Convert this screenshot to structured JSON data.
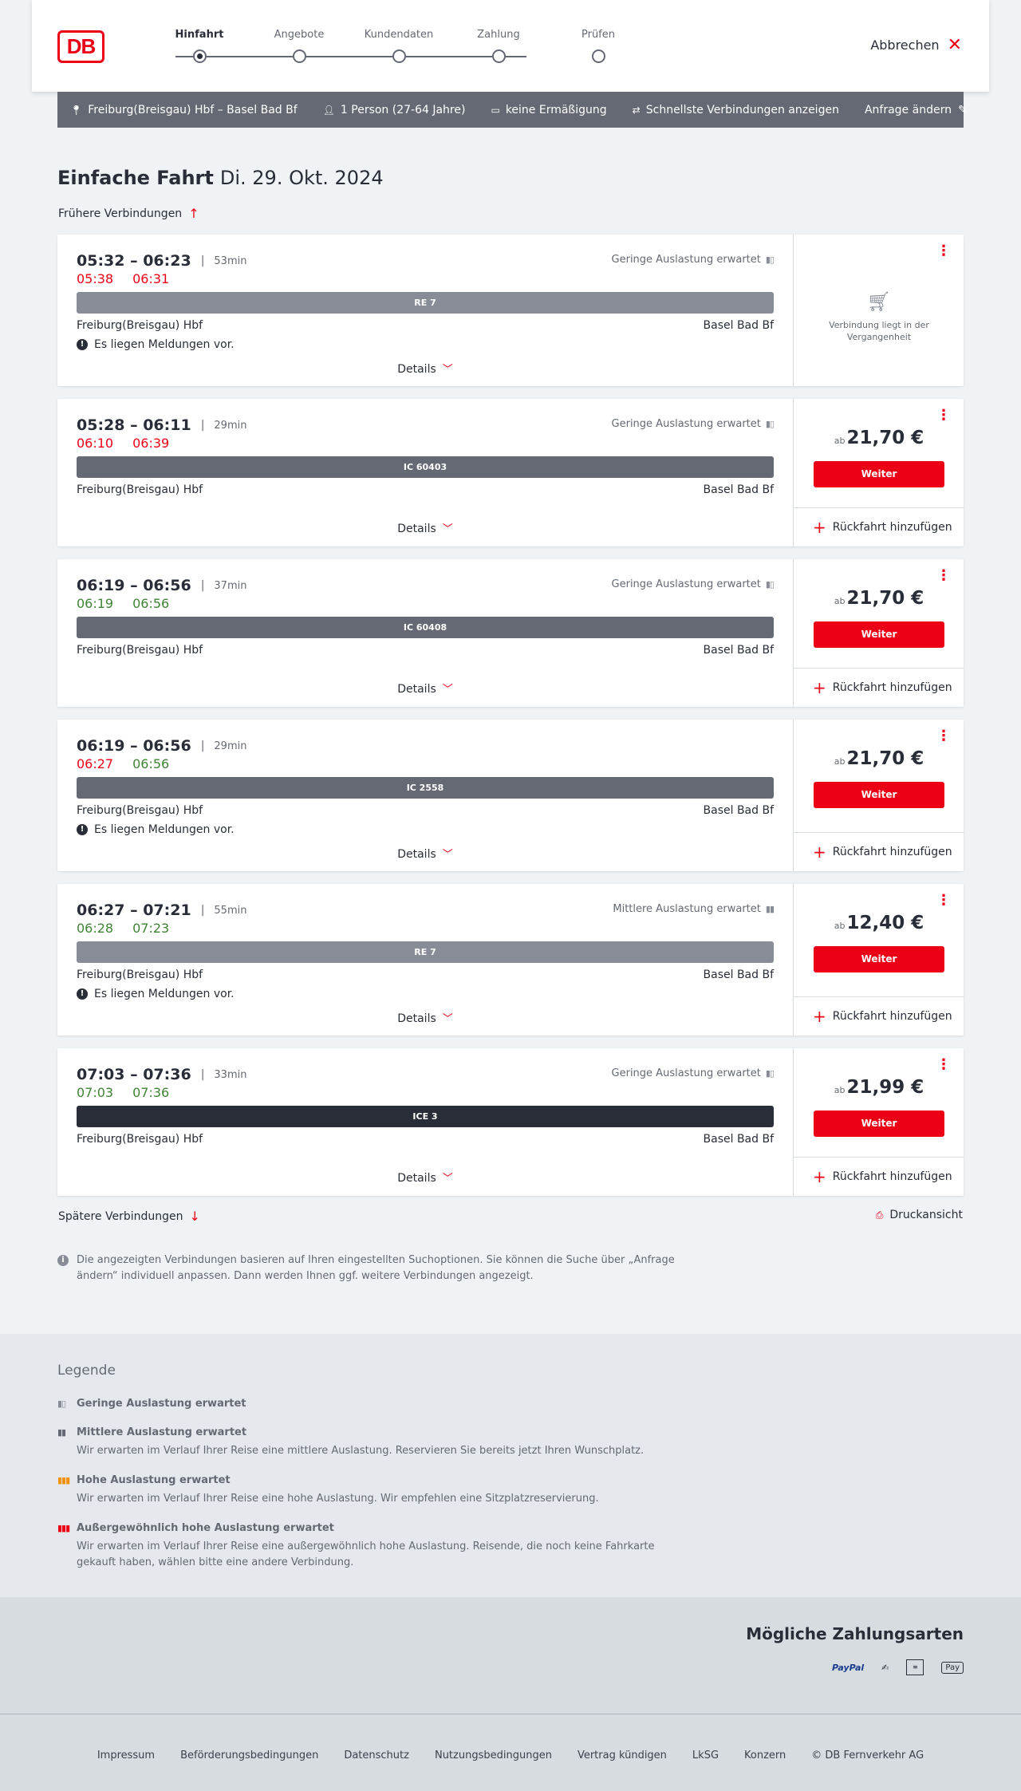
{
  "header": {
    "logo": "DB",
    "steps": [
      "Hinfahrt",
      "Angebote",
      "Kundendaten",
      "Zahlung",
      "Prüfen"
    ],
    "cancel": "Abbrechen"
  },
  "summary": {
    "route": "Freiburg(Breisgau) Hbf – Basel Bad Bf",
    "persons": "1 Person (27-64 Jahre)",
    "discount": "keine Ermäßigung",
    "fastest": "Schnellste Verbindungen anzeigen",
    "edit": "Anfrage ändern"
  },
  "title": {
    "type": "Einfache Fahrt",
    "date": "Di. 29. Okt. 2024"
  },
  "earlier": "Frühere Verbindungen",
  "later": "Spätere Verbindungen",
  "print": "Druckansicht",
  "details_label": "Details",
  "weiter_label": "Weiter",
  "return_label": "Rückfahrt hinzufügen",
  "ab_label": "ab",
  "past_label": "Verbindung liegt in der Vergangenheit",
  "connections": [
    {
      "planned": "05:32 – 06:23",
      "duration": "53min",
      "load": "Geringe Auslastung erwartet",
      "dep_rt": "05:38",
      "arr_rt": "06:31",
      "dep_status": "late",
      "arr_status": "late",
      "train": "RE 7",
      "train_color": "#878c96",
      "from": "Freiburg(Breisgau) Hbf",
      "to": "Basel Bad Bf",
      "message": "Es liegen Meldungen vor.",
      "price": ""
    },
    {
      "planned": "05:28 – 06:11",
      "duration": "29min",
      "load": "Geringe Auslastung erwartet",
      "dep_rt": "06:10",
      "arr_rt": "06:39",
      "dep_status": "late",
      "arr_status": "late",
      "train": "IC 60403",
      "train_color": "#646973",
      "from": "Freiburg(Breisgau) Hbf",
      "to": "Basel Bad Bf",
      "message": "",
      "price": "21,70 €"
    },
    {
      "planned": "06:19 – 06:56",
      "duration": "37min",
      "load": "Geringe Auslastung erwartet",
      "dep_rt": "06:19",
      "arr_rt": "06:56",
      "dep_status": "ok",
      "arr_status": "ok",
      "train": "IC 60408",
      "train_color": "#646973",
      "from": "Freiburg(Breisgau) Hbf",
      "to": "Basel Bad Bf",
      "message": "",
      "price": "21,70 €"
    },
    {
      "planned": "06:19 – 06:56",
      "duration": "29min",
      "load": "",
      "dep_rt": "06:27",
      "arr_rt": "06:56",
      "dep_status": "late",
      "arr_status": "ok",
      "train": "IC 2558",
      "train_color": "#646973",
      "from": "Freiburg(Breisgau) Hbf",
      "to": "Basel Bad Bf",
      "message": "Es liegen Meldungen vor.",
      "price": "21,70 €"
    },
    {
      "planned": "06:27 – 07:21",
      "duration": "55min",
      "load": "Mittlere Auslastung erwartet",
      "dep_rt": "06:28",
      "arr_rt": "07:23",
      "dep_status": "ok",
      "arr_status": "ok",
      "train": "RE 7",
      "train_color": "#878c96",
      "from": "Freiburg(Breisgau) Hbf",
      "to": "Basel Bad Bf",
      "message": "Es liegen Meldungen vor.",
      "price": "12,40 €"
    },
    {
      "planned": "07:03 – 07:36",
      "duration": "33min",
      "load": "Geringe Auslastung erwartet",
      "dep_rt": "07:03",
      "arr_rt": "07:36",
      "dep_status": "ok",
      "arr_status": "ok",
      "train": "ICE 3",
      "train_color": "#282d37",
      "from": "Freiburg(Breisgau) Hbf",
      "to": "Basel Bad Bf",
      "message": "",
      "price": "21,99 €"
    }
  ],
  "info_text": "Die angezeigten Verbindungen basieren auf Ihren eingestellten Suchoptionen. Sie können die Suche über „Anfrage ändern“ individuell anpassen. Dann werden Ihnen ggf. weitere Verbindungen angezeigt.",
  "legend": {
    "title": "Legende",
    "items": [
      {
        "label": "Geringe Auslastung erwartet",
        "desc": "",
        "color": "#878c96"
      },
      {
        "label": "Mittlere Auslastung erwartet",
        "desc": "Wir erwarten im Verlauf Ihrer Reise eine mittlere Auslastung. Reservieren Sie bereits jetzt Ihren Wunschplatz.",
        "color": "#646973"
      },
      {
        "label": "Hohe Auslastung erwartet",
        "desc": "Wir erwarten im Verlauf Ihrer Reise eine hohe Auslastung. Wir empfehlen eine Sitzplatzreservierung.",
        "color": "#f39200"
      },
      {
        "label": "Außergewöhnlich hohe Auslastung erwartet",
        "desc": "Wir erwarten im Verlauf Ihrer Reise eine außergewöhnlich hohe Auslastung. Reisende, die noch keine Fahrkarte gekauft haben, wählen bitte eine andere Verbindung.",
        "color": "#ec0016"
      }
    ]
  },
  "payment": {
    "title": "Mögliche Zahlungsarten",
    "paypal": "PayPal",
    "applepay": "Pay"
  },
  "footer": [
    "Impressum",
    "Beförderungsbedingungen",
    "Datenschutz",
    "Nutzungsbedingungen",
    "Vertrag kündigen",
    "LkSG",
    "Konzern",
    "© DB Fernverkehr AG"
  ],
  "colors": {
    "brand_red": "#ec0016",
    "on_time_green": "#408335"
  }
}
